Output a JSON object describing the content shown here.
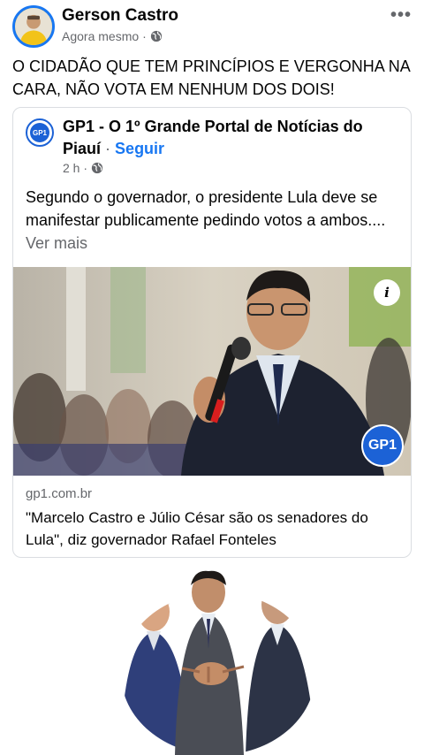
{
  "post": {
    "author": "Gerson Castro",
    "time": "Agora mesmo",
    "privacy_icon": "globe-icon",
    "more_icon": "more-options-icon",
    "more_glyph": "•••",
    "text": "O CIDADÃO QUE TEM PRINCÍPIOS E VERGONHA NA CARA, NÃO VOTA EM NENHUM DOS DOIS!"
  },
  "shared": {
    "page_name": "GP1 - O 1º Grande Portal de Notícias do Piauí",
    "separator": "·",
    "follow_label": "Seguir",
    "logo_text": "GP1",
    "time": "2 h ·",
    "text": "Segundo o governador, o presidente Lula deve se manifestar publicamente pedindo votos a ambos....",
    "see_more": "Ver mais",
    "info_glyph": "i",
    "image_badge": "GP1",
    "link_domain": "gp1.com.br",
    "link_title": "\"Marcelo Castro e Júlio César são os senadores do Lula\", diz governador Rafael Fonteles"
  },
  "colors": {
    "accent": "#1877f2",
    "gp1_blue": "#1c62d6",
    "muted": "#65676b"
  }
}
